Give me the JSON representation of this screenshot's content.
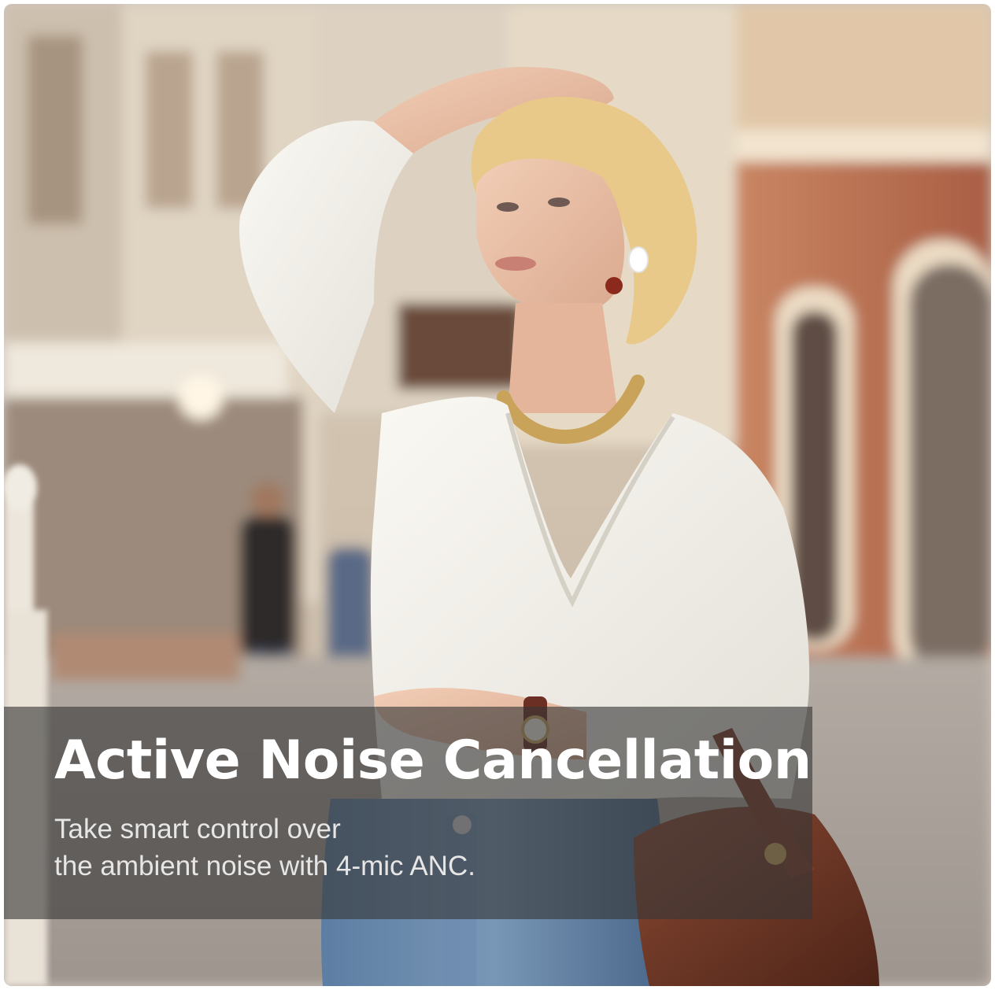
{
  "banner": {
    "headline": "Active Noise Cancellation",
    "subtitle_line1": "Take smart control over",
    "subtitle_line2": "the ambient noise with 4-mic ANC."
  },
  "colors": {
    "overlay": "#373737",
    "text": "#ffffff",
    "blouse": "#f1efe9",
    "hair": "#e8c98a",
    "jeans": "#4d6b8f",
    "bag": "#6b3322",
    "wall_right": "#b96d4f"
  }
}
